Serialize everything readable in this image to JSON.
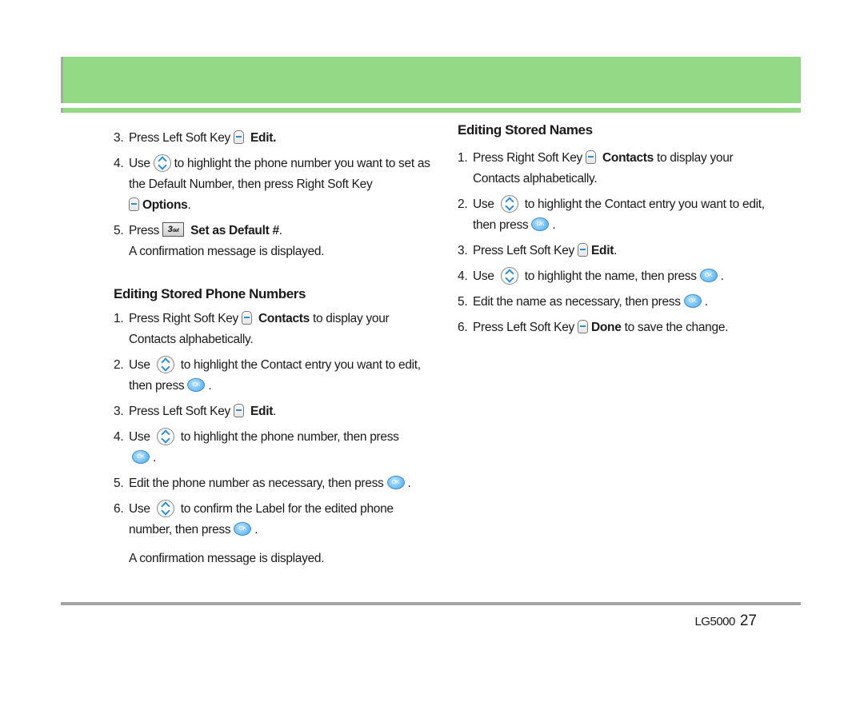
{
  "colors": {
    "header_green": "#94da86",
    "icon_blue": "#2e8fd6",
    "rule_gray": "#a3a3a3"
  },
  "left": {
    "intro_steps": [
      {
        "n": "3.",
        "pre": "Press Left Soft Key",
        "icon": "left-soft-key-icon",
        "bold": "Edit.",
        "post": ""
      },
      {
        "n": "4.",
        "pre": "Use",
        "icon": "navigation-key-icon",
        "post": "to highlight the phone number you want to set as the Default Number, then press Right Soft Key",
        "icon2": "right-soft-key-icon",
        "bold": "Options",
        "post2": "."
      },
      {
        "n": "5.",
        "pre": "Press",
        "icon": "key-3-def-icon",
        "key_label": "3",
        "key_sub": "def",
        "bold": "Set as Default #",
        "post": "."
      }
    ],
    "intro_note": "A confirmation message is displayed.",
    "section_title": "Editing Stored Phone Numbers",
    "steps": [
      {
        "n": "1.",
        "pre": "Press Right Soft Key",
        "bold": "Contacts",
        "post": "to display your Contacts alphabetically."
      },
      {
        "n": "2.",
        "pre": "Use",
        "post": "to highlight the Contact entry you want to edit, then press",
        "end": "."
      },
      {
        "n": "3.",
        "pre": "Press Left Soft Key",
        "bold": "Edit",
        "post": "."
      },
      {
        "n": "4.",
        "pre": "Use",
        "post": "to highlight the phone number, then press",
        "end": "."
      },
      {
        "n": "5.",
        "pre": "Edit the phone number as necessary, then press",
        "end": "."
      },
      {
        "n": "6.",
        "pre": "Use",
        "post": "to confirm the Label for the edited phone number, then press",
        "end": "."
      }
    ],
    "note": "A confirmation message is displayed."
  },
  "right": {
    "section_title": "Editing Stored Names",
    "steps": [
      {
        "n": "1.",
        "pre": "Press Right Soft Key",
        "bold": "Contacts",
        "post": "to display your Contacts alphabetically."
      },
      {
        "n": "2.",
        "pre": "Use",
        "post": "to highlight the Contact entry you want to edit, then press",
        "end": "."
      },
      {
        "n": "3.",
        "pre": "Press Left Soft Key",
        "bold": "Edit",
        "post": "."
      },
      {
        "n": "4.",
        "pre": "Use",
        "post": "to highlight the name, then press",
        "end": "."
      },
      {
        "n": "5.",
        "pre": "Edit the name as necessary, then press",
        "end": "."
      },
      {
        "n": "6.",
        "pre": "Press Left Soft Key",
        "bold": "Done",
        "post": "to save the change."
      }
    ]
  },
  "icons": {
    "ok_label": "OK"
  },
  "footer": {
    "model": "LG5000",
    "page": "27"
  }
}
